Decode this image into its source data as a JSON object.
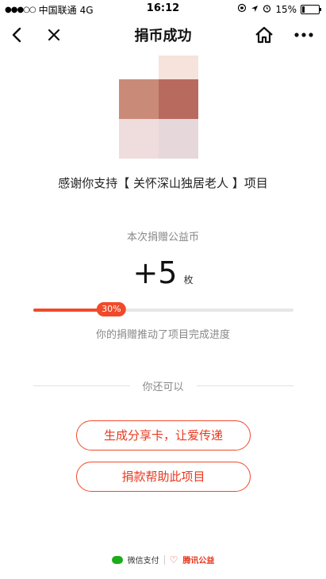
{
  "status_bar": {
    "signal_dots": "●●●○○",
    "carrier": "中国联通",
    "network": "4G",
    "time": "16:12",
    "battery_percent": "15%",
    "battery_level": 0.15
  },
  "nav": {
    "title": "捐币成功"
  },
  "avatar": {
    "colors": [
      "#ffffff",
      "#f5e3dc",
      "#c98a78",
      "#b96a5e",
      "#efdddd",
      "#e6d8da"
    ]
  },
  "thanks_text": "感谢你支持【 关怀深山独居老人 】项目",
  "donation": {
    "label": "本次捐赠公益币",
    "amount": "+5",
    "unit": "枚"
  },
  "progress": {
    "value": 0.3,
    "badge": "30%",
    "caption": "你的捐赠推动了项目完成进度"
  },
  "actions": {
    "heading": "你还可以",
    "share_label": "生成分享卡，让爱传递",
    "donate_label": "捐款帮助此项目"
  },
  "footer": {
    "wechat_pay": "微信支付",
    "tencent_charity": "腾讯公益"
  },
  "colors": {
    "accent": "#f04a2a",
    "text_muted": "#888888"
  }
}
